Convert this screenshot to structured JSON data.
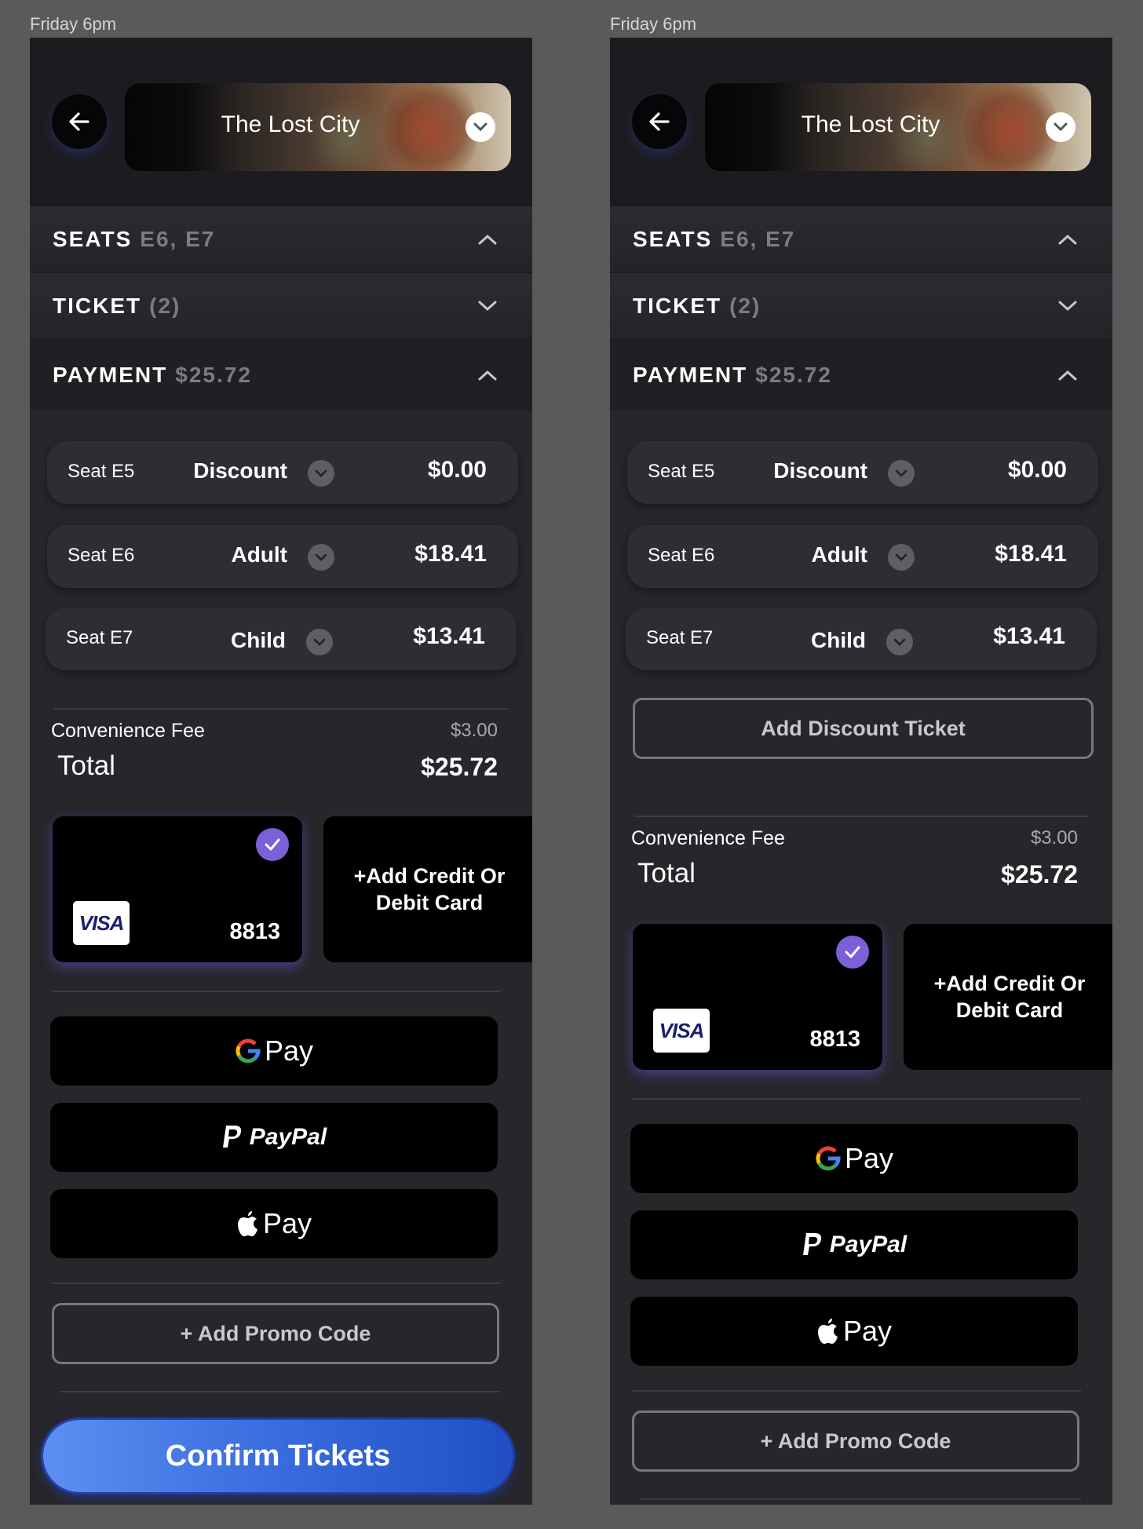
{
  "frames": [
    {
      "frame_label": "Friday 6pm",
      "movie_title": "The Lost City",
      "sections": {
        "seats": {
          "title": "SEATS",
          "sub": "E6, E7"
        },
        "ticket": {
          "title": "TICKET",
          "sub": "(2)"
        },
        "payment": {
          "title": "PAYMENT",
          "sub": "$25.72"
        }
      },
      "seat_rows": [
        {
          "seat": "Seat E5",
          "type": "Discount",
          "price": "$0.00"
        },
        {
          "seat": "Seat E6",
          "type": "Adult",
          "price": "$18.41"
        },
        {
          "seat": "Seat E7",
          "type": "Child",
          "price": "$13.41"
        }
      ],
      "convenience_fee_label": "Convenience Fee",
      "convenience_fee_value": "$3.00",
      "total_label": "Total",
      "total_value": "$25.72",
      "card": {
        "brand": "VISA",
        "last4": "8813",
        "selected": true
      },
      "add_card_label": "+Add Credit Or\nDebit Card",
      "wallets": {
        "gpay": "Pay",
        "paypal": "PayPal",
        "applepay": "Pay"
      },
      "promo_label": "+ Add Promo Code",
      "confirm_label": "Confirm Tickets"
    },
    {
      "frame_label": "Friday 6pm",
      "movie_title": "The Lost City",
      "sections": {
        "seats": {
          "title": "SEATS",
          "sub": "E6, E7"
        },
        "ticket": {
          "title": "TICKET",
          "sub": "(2)"
        },
        "payment": {
          "title": "PAYMENT",
          "sub": "$25.72"
        }
      },
      "seat_rows": [
        {
          "seat": "Seat E5",
          "type": "Discount",
          "price": "$0.00"
        },
        {
          "seat": "Seat E6",
          "type": "Adult",
          "price": "$18.41"
        },
        {
          "seat": "Seat E7",
          "type": "Child",
          "price": "$13.41"
        }
      ],
      "add_discount_label": "Add Discount Ticket",
      "convenience_fee_label": "Convenience Fee",
      "convenience_fee_value": "$3.00",
      "total_label": "Total",
      "total_value": "$25.72",
      "card": {
        "brand": "VISA",
        "last4": "8813",
        "selected": true
      },
      "add_card_label": "+Add Credit Or\nDebit Card",
      "wallets": {
        "gpay": "Pay",
        "paypal": "PayPal",
        "applepay": "Pay"
      },
      "promo_label": "+ Add Promo Code"
    }
  ],
  "colors": {
    "background": "#5a5a5a",
    "screen": "#26262b",
    "accent_purple": "#7b60d9",
    "confirm_blue": "#3c6fe0"
  }
}
